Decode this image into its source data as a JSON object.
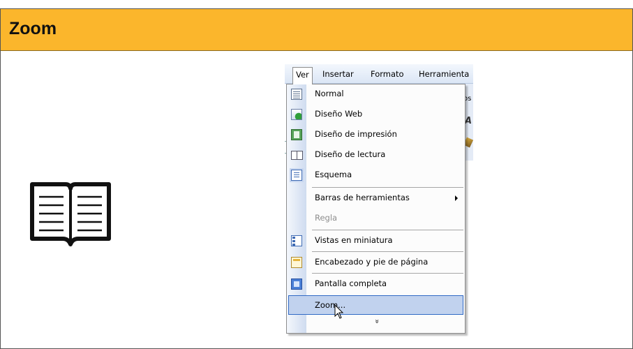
{
  "header": {
    "title": "Zoom"
  },
  "menubar": {
    "items": [
      "Ver",
      "Insertar",
      "Formato",
      "Herramienta"
    ]
  },
  "background_fragments": {
    "frag1": "os",
    "frag2": "A"
  },
  "menu": {
    "items": [
      {
        "label": "Normal",
        "icon": "normal-view-icon"
      },
      {
        "label": "Diseño Web",
        "icon": "web-layout-icon"
      },
      {
        "label": "Diseño de impresión",
        "icon": "print-layout-icon"
      },
      {
        "label": "Diseño de lectura",
        "icon": "reading-layout-icon"
      },
      {
        "label": "Esquema",
        "icon": "outline-view-icon"
      },
      {
        "label": "Barras de herramientas",
        "icon": "",
        "submenu": true
      },
      {
        "label": "Regla",
        "icon": "",
        "disabled": true
      },
      {
        "label": "Vistas en miniatura",
        "icon": "thumbnails-icon"
      },
      {
        "label": "Encabezado y pie de página",
        "icon": "header-footer-icon"
      },
      {
        "label": "Pantalla completa",
        "icon": "full-screen-icon"
      },
      {
        "label": "Zoom...",
        "icon": "",
        "highlighted": true
      }
    ],
    "expand_glyph": "»"
  },
  "colors": {
    "header_bg": "#fbb62c",
    "highlight_bg": "#c1d2ee",
    "highlight_border": "#316ac5"
  }
}
